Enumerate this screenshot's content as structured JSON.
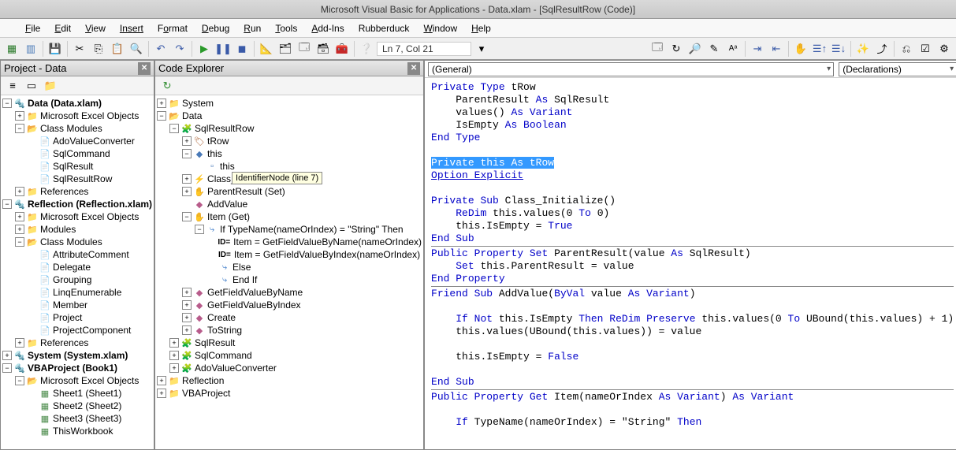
{
  "titlebar": "Microsoft Visual Basic for Applications - Data.xlam - [SqlResultRow (Code)]",
  "menus": {
    "file": "File",
    "edit": "Edit",
    "view": "View",
    "insert": "Insert",
    "format": "Format",
    "debug": "Debug",
    "run": "Run",
    "tools": "Tools",
    "addins": "Add-Ins",
    "rubberduck": "Rubberduck",
    "window": "Window",
    "help": "Help"
  },
  "cursorPos": "Ln 7, Col 21",
  "projectPanel": {
    "title": "Project - Data",
    "tree": {
      "data_root": "Data (Data.xlam)",
      "meo": "Microsoft Excel Objects",
      "classmods": "Class Modules",
      "ado": "AdoValueConverter",
      "sqlcmd": "SqlCommand",
      "sqlres": "SqlResult",
      "sqlresrow": "SqlResultRow",
      "refs": "References",
      "reflection": "Reflection (Reflection.xlam)",
      "modules": "Modules",
      "attrcomment": "AttributeComment",
      "delegate": "Delegate",
      "grouping": "Grouping",
      "linq": "LinqEnumerable",
      "member": "Member",
      "project": "Project",
      "projcomp": "ProjectComponent",
      "system": "System (System.xlam)",
      "vbaproj": "VBAProject (Book1)",
      "sheet1": "Sheet1 (Sheet1)",
      "sheet2": "Sheet2 (Sheet2)",
      "sheet3": "Sheet3 (Sheet3)",
      "thisworkbook": "ThisWorkbook"
    }
  },
  "codeExplorer": {
    "title": "Code Explorer",
    "tooltip": "IdentifierNode (line 7)",
    "tree": {
      "system": "System",
      "data": "Data",
      "sqlresrow": "SqlResultRow",
      "trow": "tRow",
      "this": "this",
      "thisfield": "this",
      "classinit": "Class_",
      "parentres": "ParentResult (Set)",
      "addvalue": "AddValue",
      "itemget": "Item (Get)",
      "ifline": "If TypeName(nameOrIndex) = \"String\" Then",
      "id1": "Item = GetFieldValueByName(nameOrIndex)",
      "id2": "Item = GetFieldValueByIndex(nameOrIndex)",
      "else": "Else",
      "endif": "End If",
      "getbyname": "GetFieldValueByName",
      "getbyidx": "GetFieldValueByIndex",
      "create": "Create",
      "tostring": "ToString",
      "sqlresult": "SqlResult",
      "sqlcommand": "SqlCommand",
      "adoconv": "AdoValueConverter",
      "reflection": "Reflection",
      "vbaproj": "VBAProject",
      "idprefix": "ID="
    }
  },
  "codeDropdowns": {
    "left": "(General)",
    "right": "(Declarations)"
  },
  "code": {
    "l1a": "Private Type",
    "l1b": " tRow",
    "l2a": "    ParentResult ",
    "l2b": "As",
    "l2c": " SqlResult",
    "l3a": "    values() ",
    "l3b": "As Variant",
    "l4a": "    IsEmpty ",
    "l4b": "As Boolean",
    "l5": "End Type",
    "l7": "Private this As tRow",
    "l8": "Option Explicit",
    "l10a": "Private Sub",
    "l10b": " Class_Initialize()",
    "l11a": "    ",
    "l11b": "ReDim",
    "l11c": " this.values(0 ",
    "l11d": "To",
    "l11e": " 0)",
    "l12a": "    this.IsEmpty = ",
    "l12b": "True",
    "l13": "End Sub",
    "l15a": "Public Property Set",
    "l15b": " ParentResult(value ",
    "l15c": "As",
    "l15d": " SqlResult)",
    "l16a": "    ",
    "l16b": "Set",
    "l16c": " this.ParentResult = value",
    "l17": "End Property",
    "l19a": "Friend Sub",
    "l19b": " AddValue(",
    "l19c": "ByVal",
    "l19d": " value ",
    "l19e": "As Variant",
    "l19f": ")",
    "l21a": "    ",
    "l21b": "If Not",
    "l21c": " this.IsEmpty ",
    "l21d": "Then ReDim Preserve",
    "l21e": " this.values(0 ",
    "l21f": "To",
    "l21g": " UBound(this.values) + 1)",
    "l22": "    this.values(UBound(this.values)) = value",
    "l24a": "    this.IsEmpty = ",
    "l24b": "False",
    "l26": "End Sub",
    "l28a": "Public Property Get",
    "l28b": " Item(nameOrIndex ",
    "l28c": "As Variant",
    "l28d": ") ",
    "l28e": "As Variant",
    "l30a": "    ",
    "l30b": "If",
    "l30c": " TypeName(nameOrIndex) = \"String\" ",
    "l30d": "Then"
  }
}
